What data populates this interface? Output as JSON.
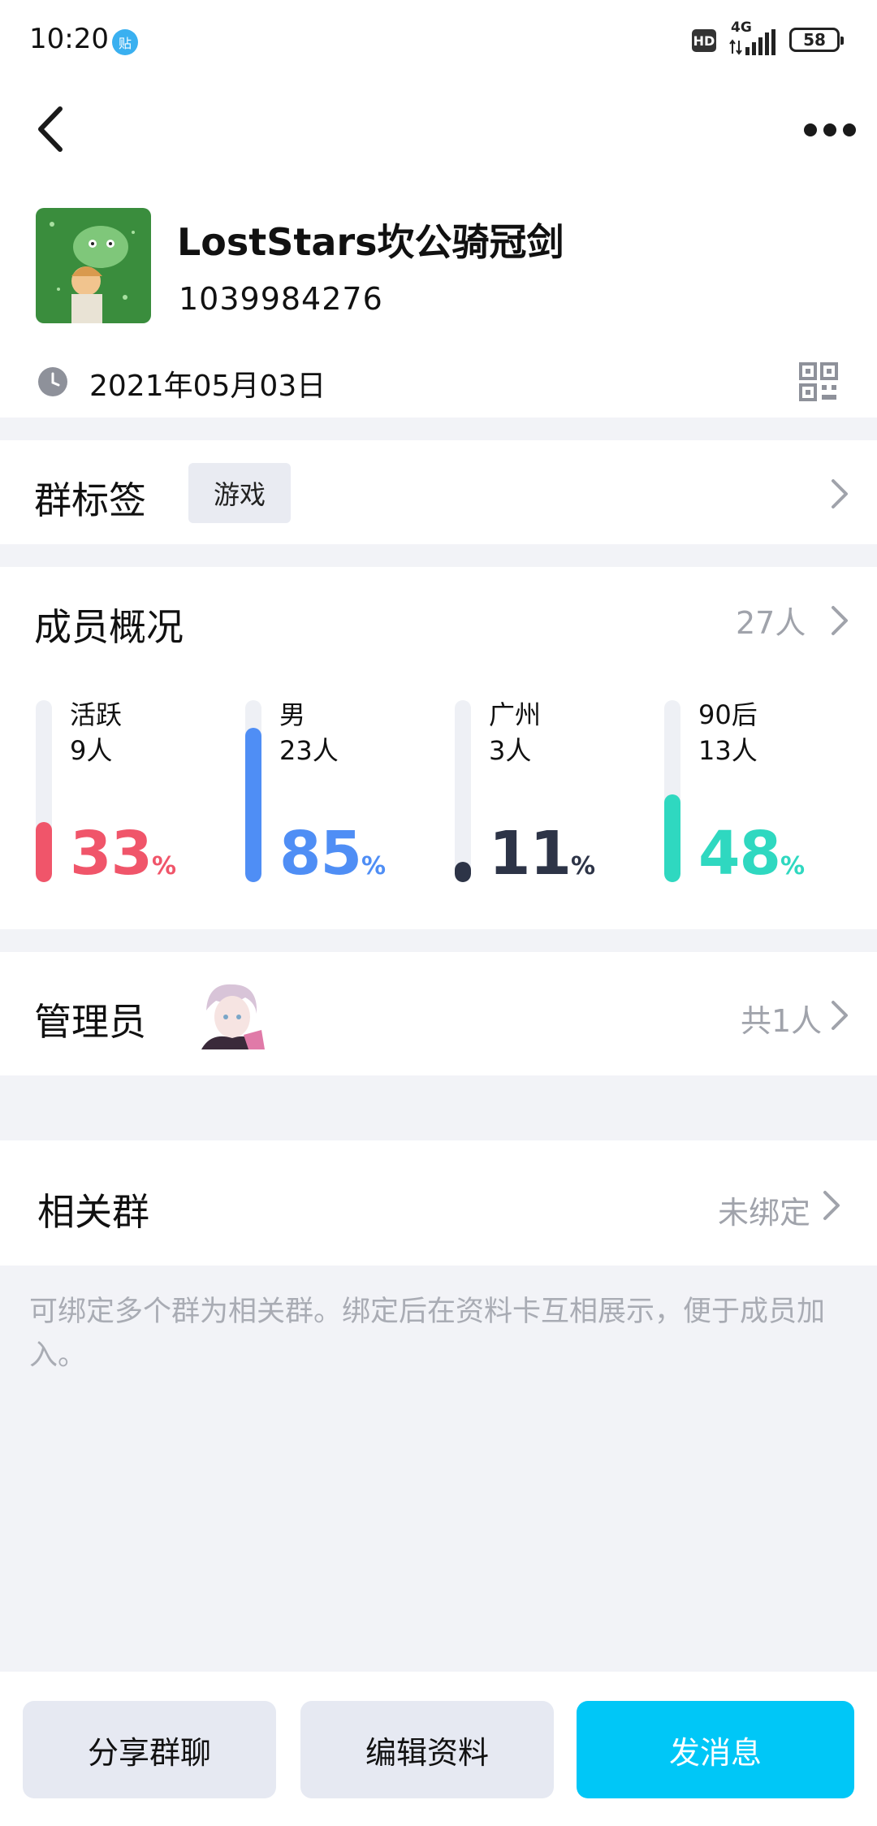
{
  "status_bar": {
    "time": "10:20",
    "notification_badge": "贴",
    "hd": "HD",
    "network": "4G",
    "battery": "58"
  },
  "group": {
    "name": "LostStars坎公骑冠剑",
    "id": "1039984276",
    "created_date": "2021年05月03日"
  },
  "tags_section": {
    "title": "群标签",
    "tags": [
      "游戏"
    ]
  },
  "members_section": {
    "title": "成员概况",
    "count": "27人",
    "stats": [
      {
        "label": "活跃",
        "count": "9人",
        "percent": "33",
        "percent_symbol": "%",
        "fill": 0.33,
        "color": "#f0556a"
      },
      {
        "label": "男",
        "count": "23人",
        "percent": "85",
        "percent_symbol": "%",
        "fill": 0.85,
        "color": "#4f8ef5"
      },
      {
        "label": "广州",
        "count": "3人",
        "percent": "11",
        "percent_symbol": "%",
        "fill": 0.11,
        "color": "#2d3447"
      },
      {
        "label": "90后",
        "count": "13人",
        "percent": "48",
        "percent_symbol": "%",
        "fill": 0.48,
        "color": "#2fd8c0"
      }
    ]
  },
  "admin_section": {
    "title": "管理员",
    "count": "共1人"
  },
  "related_section": {
    "title": "相关群",
    "status": "未绑定",
    "description": "可绑定多个群为相关群。绑定后在资料卡互相展示，便于成员加入。"
  },
  "bottom_bar": {
    "share_label": "分享群聊",
    "edit_label": "编辑资料",
    "send_label": "发消息"
  },
  "colors": {
    "accent": "#00c7f7",
    "page_bg": "#f2f3f7"
  }
}
